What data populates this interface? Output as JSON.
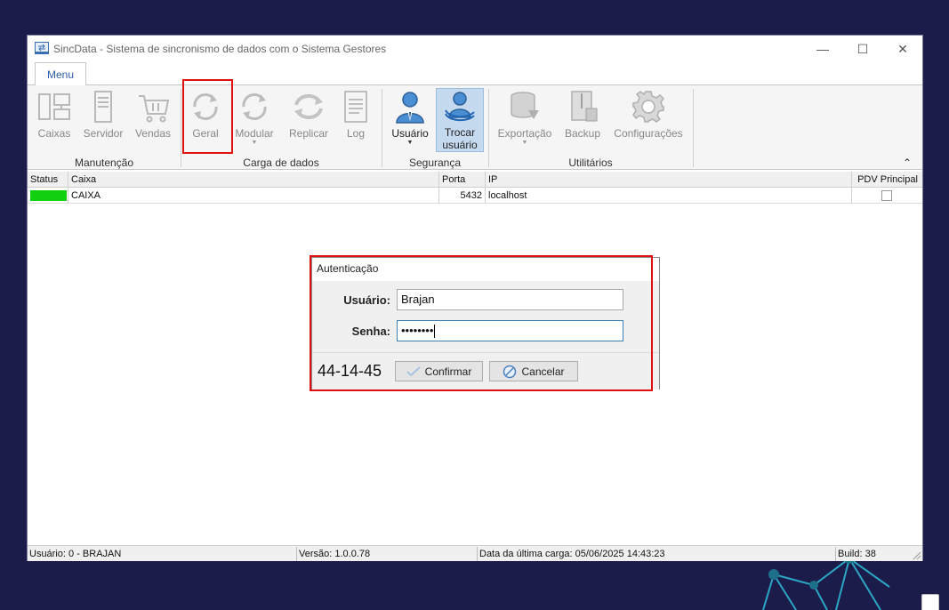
{
  "window": {
    "title": "SincData - Sistema de sincronismo de dados com o Sistema Gestores",
    "controls": {
      "minimize": "—",
      "maximize": "☐",
      "close": "✕"
    }
  },
  "ribbon": {
    "tab_label": "Menu",
    "collapse_glyph": "⌃",
    "groups": {
      "manutencao": "Manutenção",
      "carga": "Carga de dados",
      "seguranca": "Segurança",
      "utilitarios": "Utilitários"
    },
    "buttons": {
      "caixas": "Caixas",
      "servidor": "Servidor",
      "vendas": "Vendas",
      "geral": "Geral",
      "modular": "Modular",
      "replicar": "Replicar",
      "log": "Log",
      "usuario": "Usuário",
      "trocar_usuario_1": "Trocar",
      "trocar_usuario_2": "usuário",
      "exportacao": "Exportação",
      "backup": "Backup",
      "configuracoes": "Configurações"
    }
  },
  "grid": {
    "headers": {
      "status": "Status",
      "caixa": "Caixa",
      "porta": "Porta",
      "ip": "IP",
      "pdv": "PDV Principal"
    },
    "rows": [
      {
        "status_color": "#10d010",
        "caixa": "CAIXA",
        "porta": "5432",
        "ip": "localhost",
        "pdv_principal": false
      }
    ]
  },
  "dialog": {
    "title": "Autenticação",
    "usuario_label": "Usuário:",
    "usuario_value": "Brajan",
    "senha_label": "Senha:",
    "senha_value": "••••••••",
    "code": "44-14-45",
    "confirm_label": "Confirmar",
    "cancel_label": "Cancelar"
  },
  "statusbar": {
    "user": "Usuário: 0 - BRAJAN",
    "version": "Versão: 1.0.0.78",
    "last_load": "Data da última carga: 05/06/2025 14:43:23",
    "build": "Build: 38"
  },
  "colors": {
    "background": "#1b1c4a",
    "highlight": "#e01010",
    "status_ok": "#10d010",
    "selected_button": "#c5d9ef"
  }
}
